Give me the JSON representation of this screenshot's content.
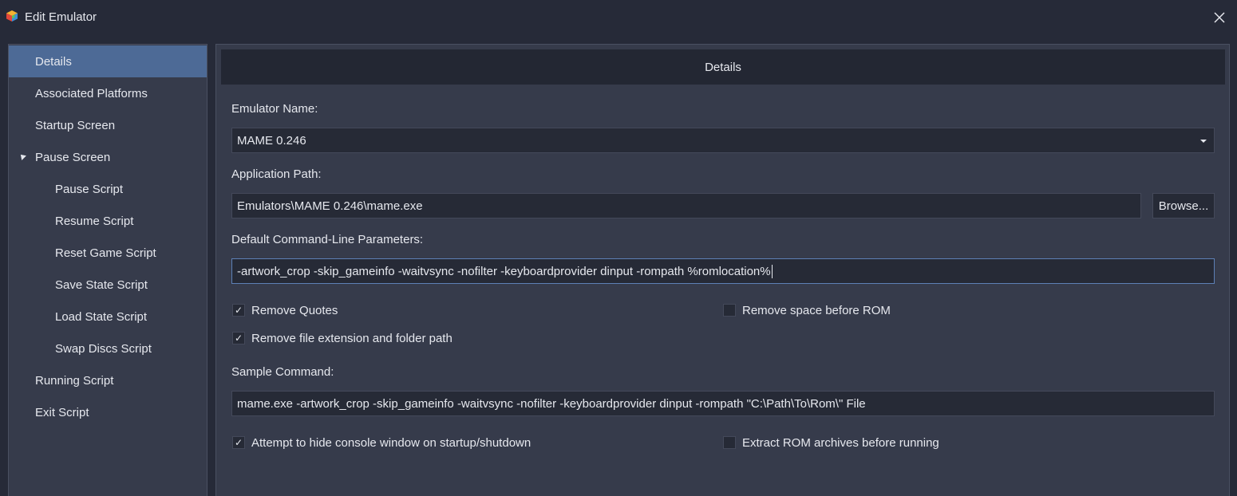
{
  "window": {
    "title": "Edit Emulator",
    "app_icon": "cube-icon",
    "close_icon": "close-icon"
  },
  "sidebar": {
    "items": [
      {
        "label": "Details",
        "selected": true
      },
      {
        "label": "Associated Platforms"
      },
      {
        "label": "Startup Screen"
      },
      {
        "label": "Pause Screen",
        "expanded": true
      },
      {
        "label": "Pause Script"
      },
      {
        "label": "Resume Script"
      },
      {
        "label": "Reset Game Script"
      },
      {
        "label": "Save State Script"
      },
      {
        "label": "Load State Script"
      },
      {
        "label": "Swap Discs Script"
      },
      {
        "label": "Running Script"
      },
      {
        "label": "Exit Script"
      }
    ]
  },
  "main": {
    "header": "Details",
    "emulator_name_label": "Emulator Name:",
    "emulator_name_value": "MAME 0.246",
    "application_path_label": "Application Path:",
    "application_path_value": "Emulators\\MAME 0.246\\mame.exe",
    "browse_label": "Browse...",
    "params_label": "Default Command-Line Parameters:",
    "params_value": "-artwork_crop -skip_gameinfo -waitvsync -nofilter -keyboardprovider dinput -rompath %romlocation%",
    "remove_quotes": {
      "label": "Remove Quotes",
      "checked": true
    },
    "remove_space": {
      "label": "Remove space before ROM",
      "checked": false
    },
    "remove_extension": {
      "label": "Remove file extension and folder path",
      "checked": true
    },
    "sample_label": "Sample Command:",
    "sample_value": "mame.exe -artwork_crop -skip_gameinfo -waitvsync -nofilter -keyboardprovider dinput -rompath \"C:\\Path\\To\\Rom\\\" File",
    "hide_console": {
      "label": "Attempt to hide console window on startup/shutdown",
      "checked": true
    },
    "extract_rom": {
      "label": "Extract ROM archives before running",
      "checked": false
    }
  },
  "colors": {
    "window_bg": "#262a38",
    "panel_bg": "#363b4b",
    "selected": "#4d6a96",
    "input_bg": "#262a36",
    "focus_border": "#5d80b6"
  }
}
